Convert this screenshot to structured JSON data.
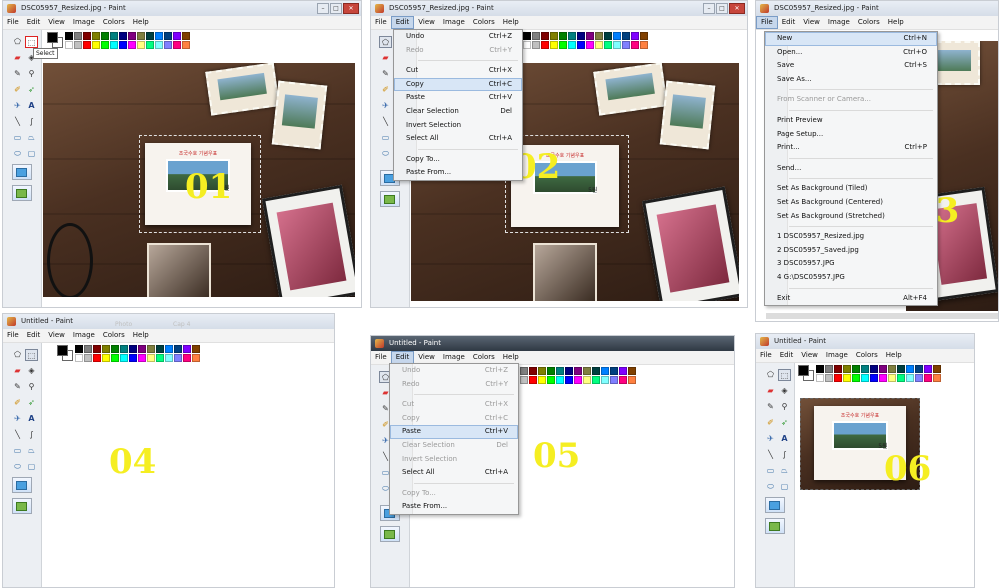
{
  "palette_colors": [
    "#000000",
    "#808080",
    "#800000",
    "#808000",
    "#008000",
    "#008080",
    "#000080",
    "#800080",
    "#808040",
    "#004040",
    "#0080ff",
    "#004080",
    "#8000ff",
    "#804000",
    "#ffffff",
    "#c0c0c0",
    "#ff0000",
    "#ffff00",
    "#00ff00",
    "#00ffff",
    "#0000ff",
    "#ff00ff",
    "#ffff80",
    "#00ff80",
    "#80ffff",
    "#8080ff",
    "#ff0080",
    "#ff8040"
  ],
  "menubar": {
    "file": "File",
    "edit": "Edit",
    "view": "View",
    "image": "Image",
    "colors": "Colors",
    "help": "Help"
  },
  "p1": {
    "title": "DSC05957_Resized.jpg - Paint",
    "tooltip": "Select",
    "step": "01"
  },
  "p2": {
    "title": "DSC05957_Resized.jpg - Paint",
    "step": "02",
    "menu": [
      {
        "label": "Undo",
        "shortcut": "Ctrl+Z"
      },
      {
        "label": "Redo",
        "shortcut": "Ctrl+Y",
        "disabled": true
      },
      {
        "sep": true
      },
      {
        "label": "Cut",
        "shortcut": "Ctrl+X"
      },
      {
        "label": "Copy",
        "shortcut": "Ctrl+C",
        "highlight": true
      },
      {
        "label": "Paste",
        "shortcut": "Ctrl+V"
      },
      {
        "label": "Clear Selection",
        "shortcut": "Del"
      },
      {
        "label": "Invert Selection",
        "shortcut": ""
      },
      {
        "label": "Select All",
        "shortcut": "Ctrl+A"
      },
      {
        "sep": true
      },
      {
        "label": "Copy To...",
        "shortcut": ""
      },
      {
        "label": "Paste From...",
        "shortcut": ""
      }
    ]
  },
  "p3": {
    "title": "DSC05957_Resized.jpg - Paint",
    "step": "03",
    "menu": [
      {
        "label": "New",
        "shortcut": "Ctrl+N",
        "highlight": true
      },
      {
        "label": "Open...",
        "shortcut": "Ctrl+O"
      },
      {
        "label": "Save",
        "shortcut": "Ctrl+S"
      },
      {
        "label": "Save As...",
        "shortcut": ""
      },
      {
        "sep": true
      },
      {
        "label": "From Scanner or Camera...",
        "shortcut": "",
        "disabled": true
      },
      {
        "sep": true
      },
      {
        "label": "Print Preview",
        "shortcut": ""
      },
      {
        "label": "Page Setup...",
        "shortcut": ""
      },
      {
        "label": "Print...",
        "shortcut": "Ctrl+P"
      },
      {
        "sep": true
      },
      {
        "label": "Send...",
        "shortcut": ""
      },
      {
        "sep": true
      },
      {
        "label": "Set As Background (Tiled)",
        "shortcut": ""
      },
      {
        "label": "Set As Background (Centered)",
        "shortcut": ""
      },
      {
        "label": "Set As Background (Stretched)",
        "shortcut": ""
      },
      {
        "sep": true
      },
      {
        "label": "1 DSC05957_Resized.jpg",
        "shortcut": ""
      },
      {
        "label": "2 DSC05957_Saved.jpg",
        "shortcut": ""
      },
      {
        "label": "3 DSC05957.JPG",
        "shortcut": ""
      },
      {
        "label": "4 G:\\DSC05957.JPG",
        "shortcut": ""
      },
      {
        "sep": true
      },
      {
        "label": "Exit",
        "shortcut": "Alt+F4"
      }
    ]
  },
  "p4": {
    "title": "Untitled - Paint",
    "step": "04",
    "ghost_left": "Photo",
    "ghost_right": "Cap 4"
  },
  "p5": {
    "title": "Untitled - Paint",
    "step": "05",
    "menu": [
      {
        "label": "Undo",
        "shortcut": "Ctrl+Z",
        "disabled": true
      },
      {
        "label": "Redo",
        "shortcut": "Ctrl+Y",
        "disabled": true
      },
      {
        "sep": true
      },
      {
        "label": "Cut",
        "shortcut": "Ctrl+X",
        "disabled": true
      },
      {
        "label": "Copy",
        "shortcut": "Ctrl+C",
        "disabled": true
      },
      {
        "label": "Paste",
        "shortcut": "Ctrl+V",
        "highlight": true
      },
      {
        "label": "Clear Selection",
        "shortcut": "Del",
        "disabled": true
      },
      {
        "label": "Invert Selection",
        "shortcut": "",
        "disabled": true
      },
      {
        "label": "Select All",
        "shortcut": "Ctrl+A"
      },
      {
        "sep": true
      },
      {
        "label": "Copy To...",
        "shortcut": "",
        "disabled": true
      },
      {
        "label": "Paste From...",
        "shortcut": ""
      }
    ]
  },
  "p6": {
    "title": "Untitled - Paint",
    "step": "06"
  }
}
